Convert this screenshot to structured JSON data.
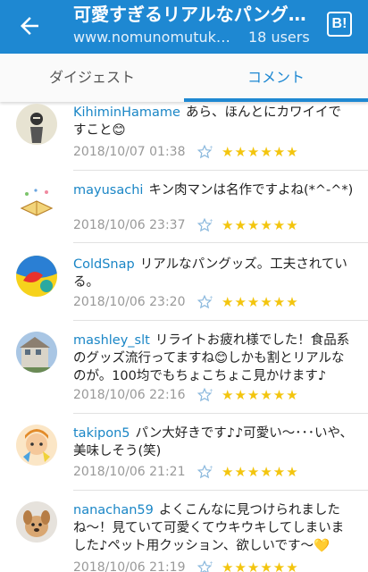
{
  "header": {
    "title": "可愛すぎるリアルなパング…",
    "url": "www.nomunomutuk…",
    "user_count": "18 users",
    "logo": "B!",
    "back_icon": "arrow-left-icon",
    "bg_color": "#1e88d2"
  },
  "tabs": [
    {
      "label": "ダイジェスト",
      "active": false
    },
    {
      "label": "コメント",
      "active": true
    }
  ],
  "comments": [
    {
      "user": "KihiminHamame",
      "text": "あら、ほんとにカワイイですこと😊",
      "date": "2018/10/07 01:38",
      "stars": "★★★★★★"
    },
    {
      "user": "mayusachi",
      "text": "キン肉マンは名作ですよね(*^-^*)",
      "date": "2018/10/06 23:37",
      "stars": "★★★★★★"
    },
    {
      "user": "ColdSnap",
      "text": "リアルなパングッズ。工夫されている。",
      "date": "2018/10/06 23:20",
      "stars": "★★★★★★"
    },
    {
      "user": "mashley_slt",
      "text": "リライトお疲れ様でした！食品系のグッズ流行ってますね😊しかも割とリアルなのが。100均でもちょこちょこ見かけます♪",
      "date": "2018/10/06 22:16",
      "stars": "★★★★★★"
    },
    {
      "user": "takipon5",
      "text": "パン大好きです♪♪可愛い〜･･･いや、美味しそう(笑)",
      "date": "2018/10/06 21:21",
      "stars": "★★★★★★"
    },
    {
      "user": "nanachan59",
      "text": "よくこんなに見つけられましたね〜！見ていて可愛くてウキウキしてしまいました♪ペット用クッション、欲しいです〜💛",
      "date": "2018/10/06 21:19",
      "stars": "★★★★★★"
    }
  ]
}
